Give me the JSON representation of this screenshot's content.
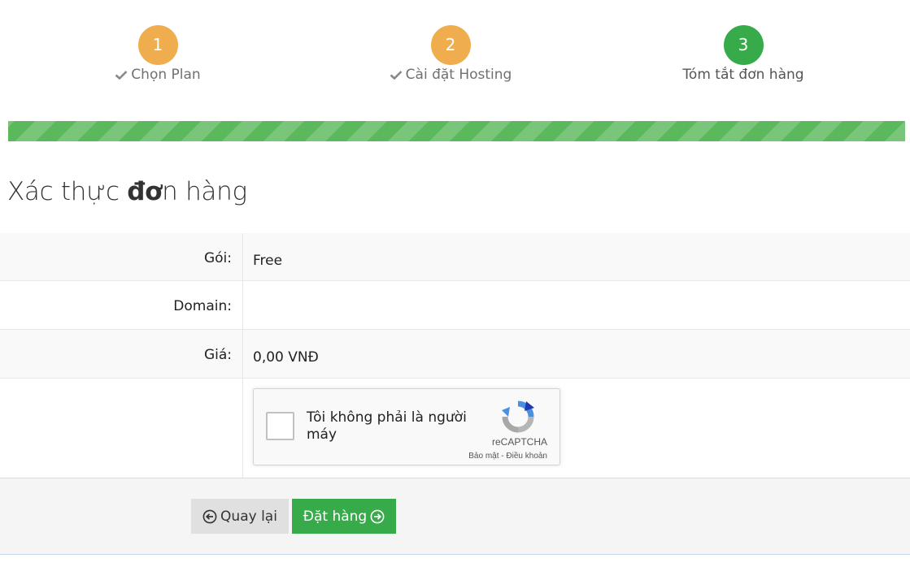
{
  "steps": [
    {
      "number": "1",
      "label": "Chọn Plan",
      "status": "completed"
    },
    {
      "number": "2",
      "label": "Cài đặt Hosting",
      "status": "completed"
    },
    {
      "number": "3",
      "label": "Tóm tắt đơn hàng",
      "status": "current"
    }
  ],
  "progress": {
    "percent": 100
  },
  "title": {
    "part1": "Xác thực ",
    "bold": "đơ",
    "part2": "n hàng"
  },
  "summary": {
    "package_label": "Gói:",
    "package_value": "Free",
    "domain_label": "Domain:",
    "domain_value": "",
    "price_label": "Giá:",
    "price_value": "0,00 VNĐ"
  },
  "recaptcha": {
    "text": "Tôi không phải là người máy",
    "brand": "reCAPTCHA",
    "privacy": "Bảo mật",
    "separator": " - ",
    "terms": "Điều khoản"
  },
  "actions": {
    "back_label": "Quay lại",
    "order_label": "Đặt hàng"
  },
  "colors": {
    "step_pending": "#f0ad4e",
    "step_active": "#37ab4a",
    "progress": "#5cb85c",
    "order_button": "#37ab4a",
    "back_button": "#e0e0e0"
  },
  "icons": {
    "step_check": "check-icon",
    "back": "circle-arrow-left-icon",
    "order": "circle-arrow-right-icon",
    "recaptcha": "recaptcha-logo-icon"
  }
}
